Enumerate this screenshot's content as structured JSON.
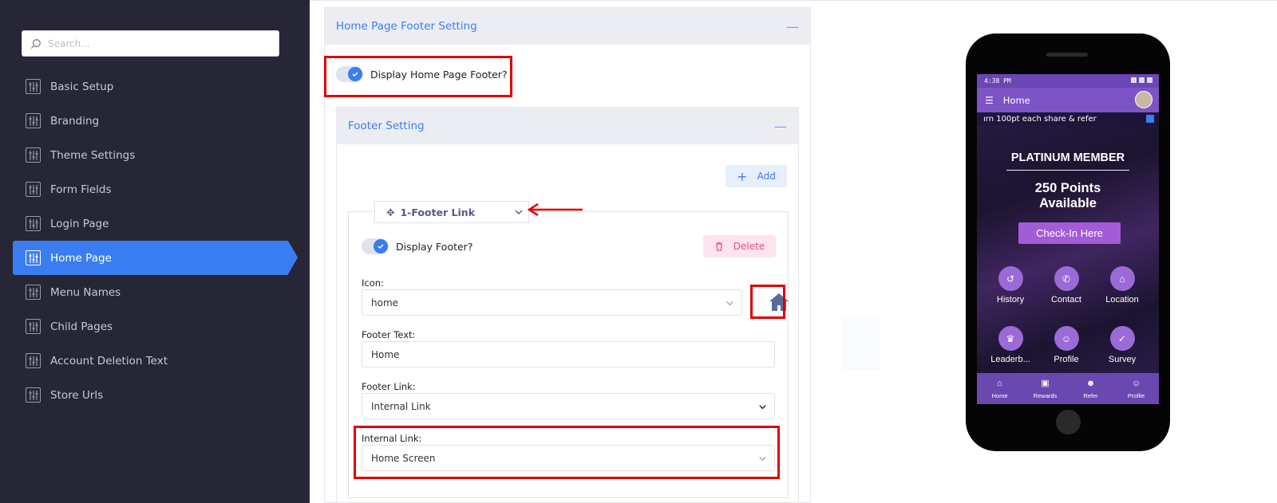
{
  "sidebar": {
    "search_placeholder": "Search...",
    "items": [
      {
        "label": "Basic Setup"
      },
      {
        "label": "Branding"
      },
      {
        "label": "Theme Settings"
      },
      {
        "label": "Form Fields"
      },
      {
        "label": "Login Page"
      },
      {
        "label": "Home Page",
        "active": true
      },
      {
        "label": "Menu Names"
      },
      {
        "label": "Child Pages"
      },
      {
        "label": "Account Deletion Text"
      },
      {
        "label": "Store Urls"
      }
    ]
  },
  "main": {
    "panel_title": "Home Page Footer Setting",
    "display_footer_label": "Display Home Page Footer?",
    "footer_setting_title": "Footer Setting",
    "add_label": "Add",
    "card": {
      "tab_label": "1-Footer Link",
      "display_label": "Display Footer?",
      "delete_label": "Delete",
      "icon_label": "Icon:",
      "icon_value": "home",
      "footer_text_label": "Footer Text:",
      "footer_text_value": "Home",
      "footer_link_label": "Footer Link:",
      "footer_link_value": "Internal Link",
      "internal_link_label": "Internal Link:",
      "internal_link_value": "Home Screen"
    }
  },
  "phone": {
    "time": "4:38 PM",
    "app_title": "Home",
    "ticker": "ırn 100pt each share & refer",
    "member": "PLATINUM MEMBER",
    "points_line1": "250 Points",
    "points_line2": "Available",
    "checkin": "Check-In Here",
    "tiles": [
      {
        "label": "History",
        "icon": "history-icon"
      },
      {
        "label": "Contact",
        "icon": "phone-icon"
      },
      {
        "label": "Location",
        "icon": "home-icon"
      },
      {
        "label": "Leaderb...",
        "icon": "trophy-icon"
      },
      {
        "label": "Profile",
        "icon": "user-edit-icon"
      },
      {
        "label": "Survey",
        "icon": "check-icon"
      }
    ],
    "bottom_nav": [
      {
        "label": "Home",
        "icon": "home-icon"
      },
      {
        "label": "Rewards",
        "icon": "gift-icon"
      },
      {
        "label": "Refer",
        "icon": "users-icon"
      },
      {
        "label": "Profile",
        "icon": "user-edit-icon"
      }
    ]
  },
  "colors": {
    "accent": "#3a7df0",
    "sidebar_bg": "#262636",
    "highlight_red": "#e00000",
    "phone_purple": "#7c54c6"
  }
}
